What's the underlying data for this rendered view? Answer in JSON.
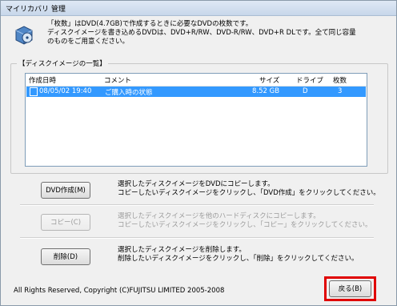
{
  "window": {
    "title": "マイリカバリ 管理"
  },
  "intro": {
    "line1": "「枚数」はDVD(4.7GB)で作成するときに必要なDVDの枚数です。",
    "line2": "ディスクイメージを書き込めるDVDは、DVD+R/RW、DVD-R/RW、DVD+R DLです。全て同じ容量",
    "line3": "のものをご用意ください。"
  },
  "list": {
    "group_label": "【ディスクイメージの一覧】",
    "headers": {
      "date": "作成日時",
      "comment": "コメント",
      "size": "サイズ",
      "drive": "ドライブ",
      "count": "枚数"
    },
    "rows": [
      {
        "date": "08/05/02 19:40",
        "comment": "ご購入時の状態",
        "size": "8.52 GB",
        "drive": "D",
        "count": "3"
      }
    ]
  },
  "actions": {
    "dvd": {
      "label": "DVD作成(M)",
      "line1": "選択したディスクイメージをDVDにコピーします。",
      "line2": "コピーしたいディスクイメージをクリックし、「DVD作成」をクリックしてください。"
    },
    "copy": {
      "label": "コピー(C)",
      "line1": "選択したディスクイメージを他のハードディスクにコピーします。",
      "line2": "コピーしたいディスクイメージをクリックし、「コピー」をクリックしてください。"
    },
    "delete": {
      "label": "削除(D)",
      "line1": "選択したディスクイメージを削除します。",
      "line2": "削除したいディスクイメージをクリックし、「削除」をクリックしてください。"
    }
  },
  "footer": {
    "copyright": "All Rights Reserved, Copyright (C)FUJITSU LIMITED 2005-2008",
    "back_label": "戻る(B)"
  },
  "colors": {
    "selection": "#3399ff",
    "highlight": "#e00000"
  },
  "icons": {
    "app": "recovery-disc-icon"
  }
}
